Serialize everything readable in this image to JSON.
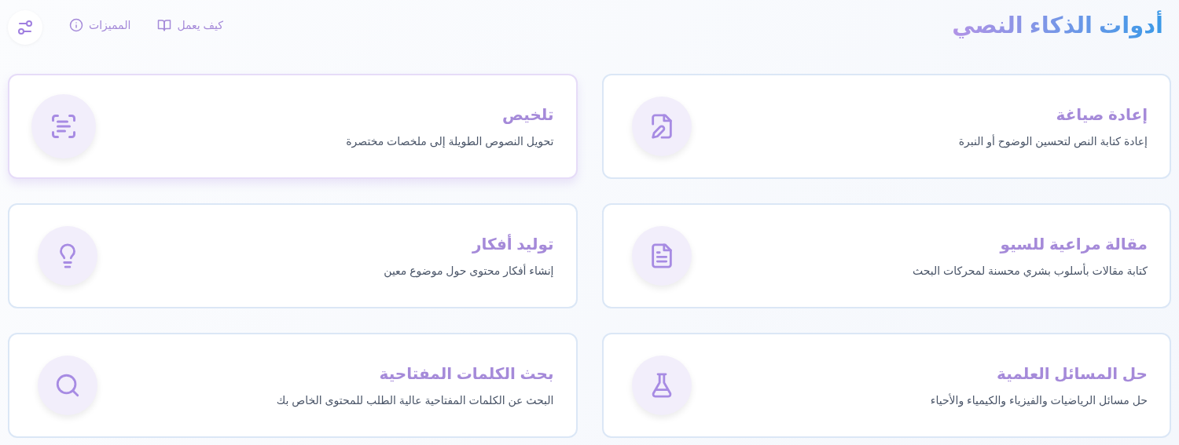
{
  "header": {
    "title": "أدوات الذكاء النصي",
    "nav": [
      {
        "label": "كيف يعمل",
        "kind": "book"
      },
      {
        "label": "المميزات",
        "kind": "info"
      }
    ]
  },
  "tools": [
    {
      "title": "إعادة صياغة",
      "description": "إعادة كتابة النص لتحسين الوضوح أو النبرة",
      "kind": "rewrite",
      "selected": false
    },
    {
      "title": "تلخيص",
      "description": "تحويل النصوص الطويلة إلى ملخصات مختصرة",
      "kind": "summary",
      "selected": true
    },
    {
      "title": "مقالة مراعية للسيو",
      "description": "كتابة مقالات بأسلوب بشري محسنة لمحركات البحث",
      "kind": "article",
      "selected": false
    },
    {
      "title": "توليد أفكار",
      "description": "إنشاء أفكار محتوى حول موضوع معين",
      "kind": "ideas",
      "selected": false
    },
    {
      "title": "حل المسائل العلمية",
      "description": "حل مسائل الرياضيات والفيزياء والكيمياء والأحياء",
      "kind": "science",
      "selected": false
    },
    {
      "title": "بحث الكلمات المفتاحية",
      "description": "البحث عن الكلمات المفتاحية عالية الطلب للمحتوى الخاص بك",
      "kind": "keywords",
      "selected": false
    }
  ]
}
